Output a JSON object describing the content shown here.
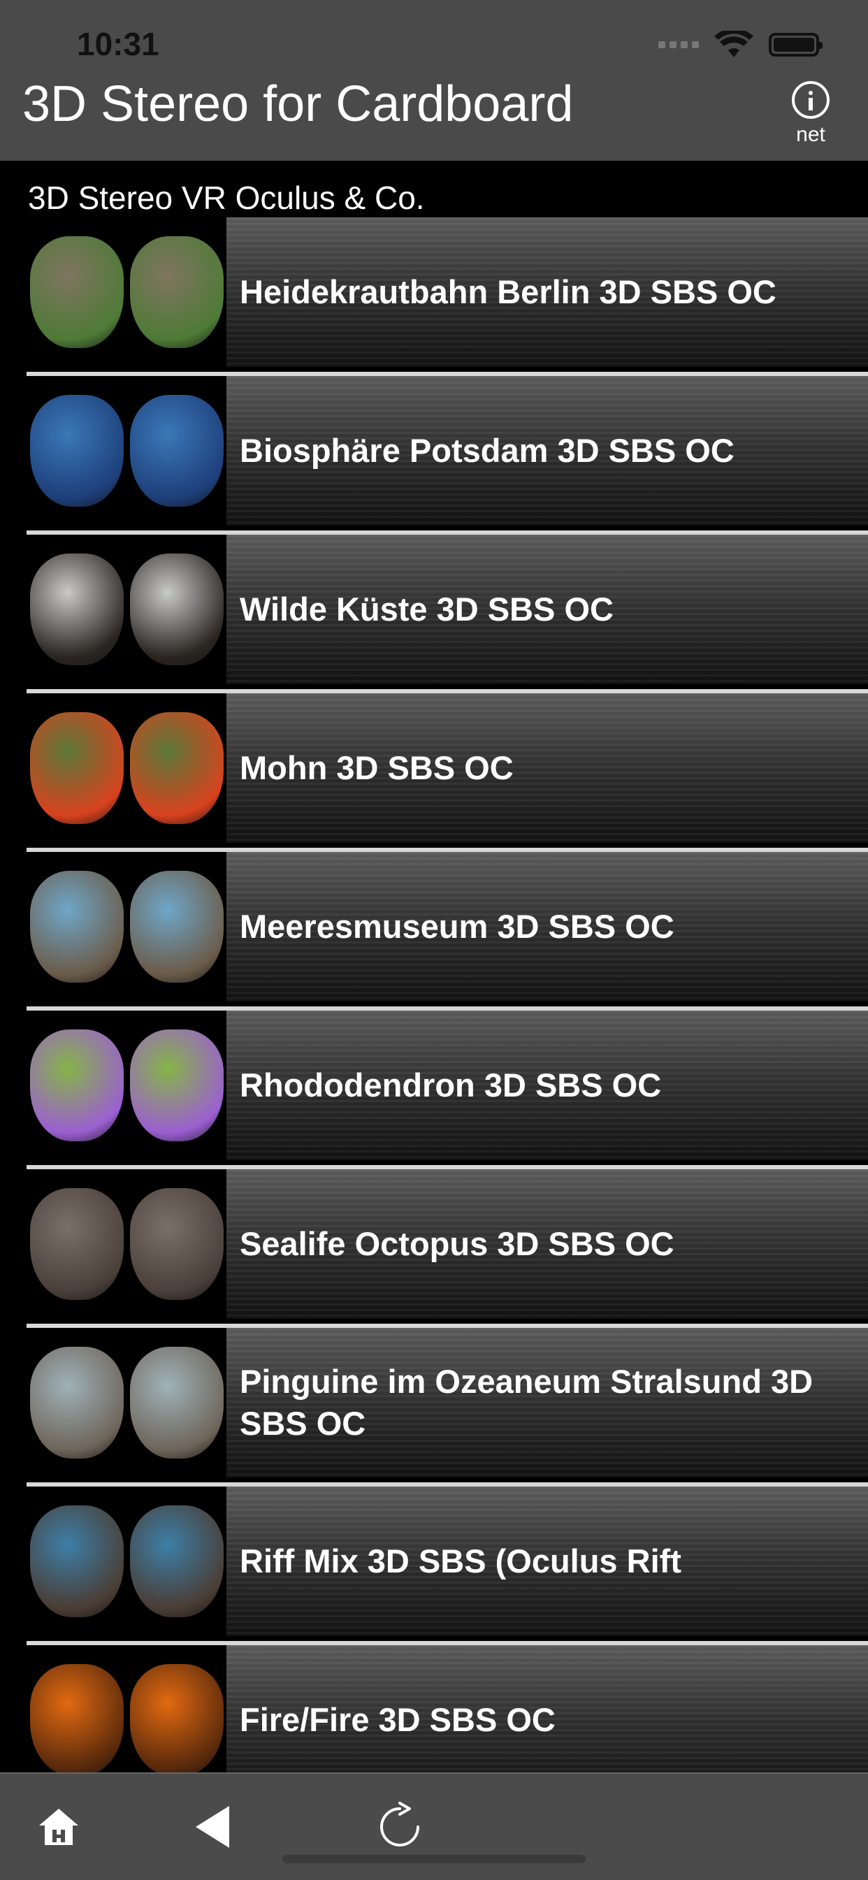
{
  "status": {
    "time": "10:31"
  },
  "nav": {
    "title": "3D Stereo for Cardboard",
    "info_label": "net"
  },
  "section": {
    "title": "3D Stereo VR Oculus & Co."
  },
  "items": [
    {
      "label": "Heidekrautbahn Berlin 3D SBS OC",
      "colors": [
        "#7f7560",
        "#4e7a36"
      ]
    },
    {
      "label": "Biosphäre Potsdam 3D SBS OC",
      "colors": [
        "#3a78b8",
        "#1e3f7a"
      ]
    },
    {
      "label": "Wilde Küste 3D SBS OC",
      "colors": [
        "#c9c9c9",
        "#2b2622"
      ]
    },
    {
      "label": "Mohn 3D SBS OC",
      "colors": [
        "#5c7a3a",
        "#d8421e"
      ]
    },
    {
      "label": "Meeresmuseum 3D SBS OC",
      "colors": [
        "#6fa6c8",
        "#6b5c4a"
      ]
    },
    {
      "label": "Rhododendron 3D SBS OC",
      "colors": [
        "#86b447",
        "#9b5fd1"
      ]
    },
    {
      "label": "Sealife Octopus 3D SBS OC",
      "colors": [
        "#7b7068",
        "#4b3f3a"
      ]
    },
    {
      "label": "Pinguine im Ozeaneum Stralsund 3D SBS OC",
      "colors": [
        "#9fb2b8",
        "#6e655a"
      ]
    },
    {
      "label": "Riff Mix 3D SBS (Oculus Rift",
      "colors": [
        "#3d7fa8",
        "#4a3d34"
      ]
    },
    {
      "label": "Fire/Fire 3D SBS OC",
      "colors": [
        "#e26a12",
        "#5a2a0b"
      ]
    }
  ],
  "toolbar": {
    "icons": [
      "home-icon",
      "back-icon",
      "refresh-icon"
    ]
  }
}
